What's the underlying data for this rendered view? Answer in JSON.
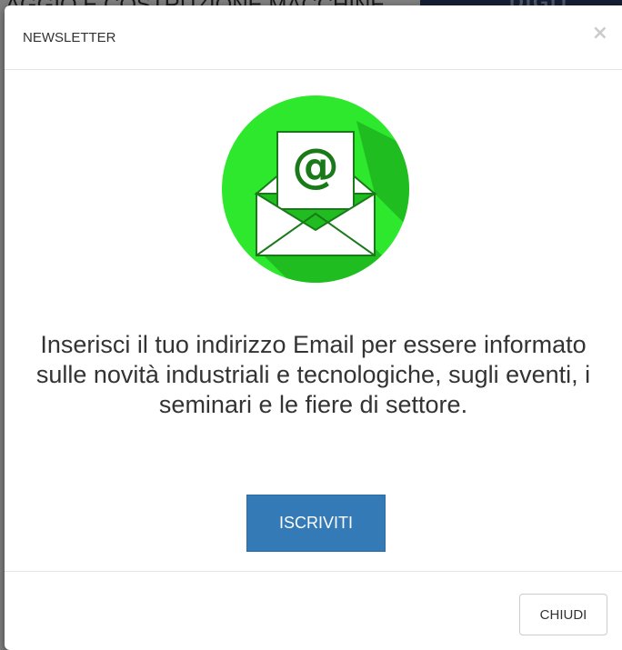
{
  "background": {
    "heading": "AGGIO E COSTRUZIONE MACCHINE",
    "banner_text": "DIGIT"
  },
  "modal": {
    "title": "NEWSLETTER",
    "close_symbol": "×",
    "icon": "email-envelope-icon",
    "icon_glyph": "@",
    "message": "Inserisci il tuo indirizzo Email per essere informato sulle novità industriali e tecnologiche, sugli eventi, i seminari e le fiere di settore.",
    "subscribe_label": "ISCRIVITI",
    "close_label": "CHIUDI"
  },
  "colors": {
    "icon_circle": "#2ee82e",
    "icon_glyph": "#1a7a1a",
    "primary_button": "#337ab7",
    "overlay": "rgba(0,0,0,0.5)"
  }
}
